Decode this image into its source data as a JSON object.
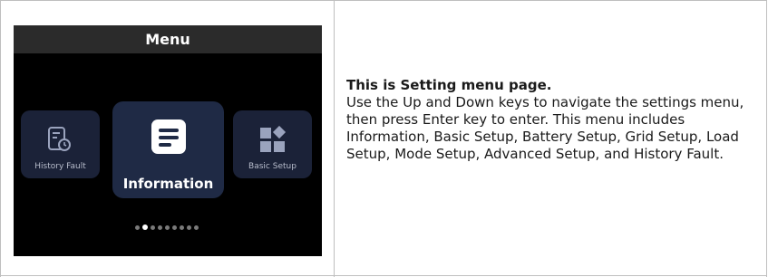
{
  "menu": {
    "title": "Menu",
    "items": [
      {
        "label": "History Fault",
        "icon": "history-fault-icon"
      },
      {
        "label": "Information",
        "icon": "information-icon"
      },
      {
        "label": "Basic Setup",
        "icon": "basic-setup-icon"
      }
    ],
    "page_indicator": {
      "count": 9,
      "active_index": 1
    }
  },
  "description": {
    "title": "This is Setting menu page.",
    "body": "Use the Up and Down keys to navigate the settings menu, then press Enter key to enter. This menu includes Information, Basic Setup, Battery Setup, Grid Setup, Load Setup, Mode Setup, Advanced Setup, and History Fault."
  },
  "colors": {
    "screen_bg": "#000000",
    "header_bg": "#2b2b2b",
    "card_bg": "#1b2238",
    "active_card_bg": "#1f2a45"
  }
}
